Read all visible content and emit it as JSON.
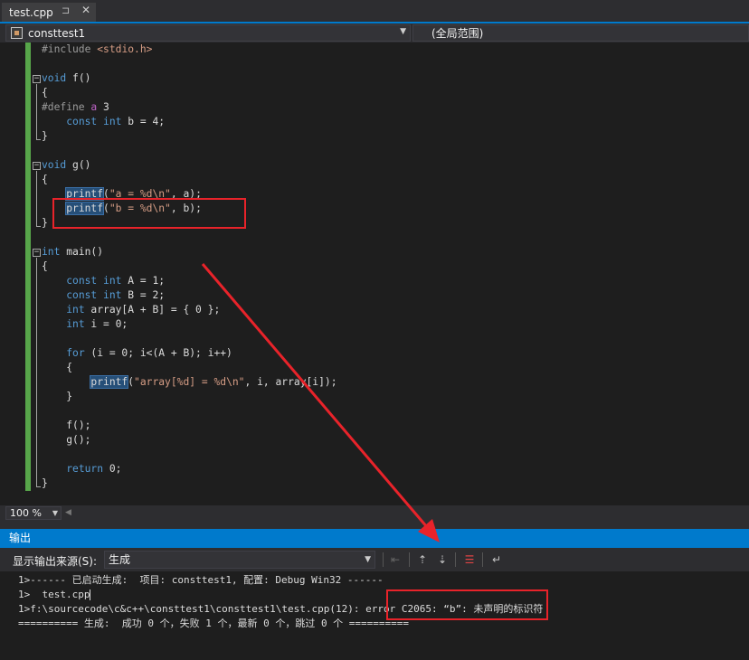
{
  "tab": {
    "title": "test.cpp",
    "pin": "⊐",
    "close": "✕"
  },
  "nav": {
    "scope": "consttest1",
    "global": "(全局范围)"
  },
  "code": {
    "l1": "#include",
    "l1b": "<stdio.h>",
    "void": "void",
    "int": "int",
    "const": "const",
    "for": "for",
    "return": "return",
    "define": "#define",
    "a": "a",
    "f_decl": " f()",
    "g_decl": " g()",
    "main_decl": " main()",
    "open": "{",
    "close": "}",
    "define_rest": " 3",
    "b_decl": " b = 4;",
    "printf": "printf",
    "p1_open": "(",
    "p1_str": "\"a = %d\\n\"",
    "p1_rest": ", a);",
    "p2_str": "\"b = %d\\n\"",
    "p2_rest": ", b);",
    "A_decl": " A = 1;",
    "B_decl": " B = 2;",
    "array_decl": " array[A + B] = { 0 };",
    "i_decl": " i = 0;",
    "for_rest": " (i = 0; i<(A + B); i++)",
    "p3_str": "\"array[%d] = %d\\n\"",
    "p3_rest": ", i, array[i]);",
    "f_call": "f();",
    "g_call": "g();",
    "ret_rest": " 0;"
  },
  "zoom": {
    "value": "100 %"
  },
  "output": {
    "title": "输出",
    "source_label": "显示输出来源(S):",
    "source_value": "生成",
    "lines": [
      "1>------ 已启动生成:  项目: consttest1, 配置: Debug Win32 ------",
      "1>  test.cpp",
      "1>f:\\sourcecode\\c&c++\\consttest1\\consttest1\\test.cpp(12): error C2065: “b”: 未声明的标识符",
      "========== 生成:  成功 0 个，失败 1 个，最新 0 个，跳过 0 个 =========="
    ]
  },
  "colors": {
    "accent": "#007acc",
    "annotation": "#e8232a",
    "change_bar": "#57a64a"
  }
}
